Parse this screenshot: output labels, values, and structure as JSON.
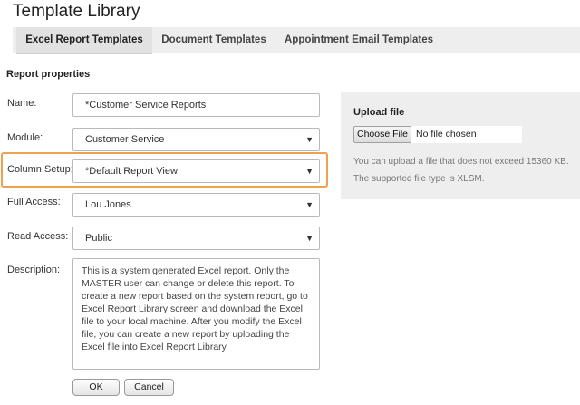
{
  "title": "Template Library",
  "tabs": [
    {
      "label": "Excel Report Templates"
    },
    {
      "label": "Document Templates"
    },
    {
      "label": "Appointment Email Templates"
    }
  ],
  "section_title": "Report properties",
  "form": {
    "name_label": "Name:",
    "name_value": "*Customer Service Reports",
    "module_label": "Module:",
    "module_value": "Customer Service",
    "column_label": "Column Setup:",
    "column_value": "*Default Report View",
    "full_access_label": "Full Access:",
    "full_access_value": "Lou Jones",
    "read_access_label": "Read Access:",
    "read_access_value": "Public",
    "description_label": "Description:",
    "description_value": "This is a system generated Excel report. Only the MASTER user can change or delete this report. To create a new report based on the system report, go to Excel Report Library screen and download the Excel file to your local machine. After you modify the Excel file, you can create a new report by uploading the Excel file into Excel Report Library."
  },
  "buttons": {
    "ok": "OK",
    "cancel": "Cancel"
  },
  "upload": {
    "title": "Upload file",
    "choose_label": "Choose File",
    "no_file": "No file chosen",
    "note1": "You can upload a file that does not exceed 15360 KB.",
    "note2": "The supported file type is XLSM."
  },
  "colors": {
    "highlight": "#f0a050",
    "panel": "#eeeeee"
  }
}
